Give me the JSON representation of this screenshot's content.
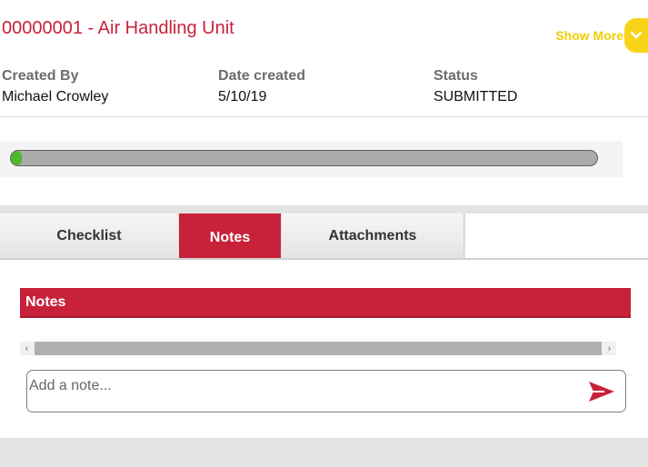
{
  "header": {
    "title": "00000001 - Air Handling Unit",
    "show_more_label": "Show More"
  },
  "meta": {
    "created_by_label": "Created By",
    "created_by_value": "Michael Crowley",
    "date_created_label": "Date created",
    "date_created_value": "5/10/19",
    "status_label": "Status",
    "status_value": "SUBMITTED"
  },
  "progress": {
    "fraction": 0.0
  },
  "tabs": [
    {
      "label": "Checklist",
      "active": false
    },
    {
      "label": "Notes",
      "active": true
    },
    {
      "label": "Attachments",
      "active": false
    }
  ],
  "notes": {
    "section_title": "Notes",
    "input_placeholder": "Add a note...",
    "input_value": ""
  },
  "icons": {
    "show_more": "chevron-down-icon",
    "send": "send-icon",
    "scroll_left": "chevron-left-icon",
    "scroll_right": "chevron-right-icon"
  },
  "colors": {
    "brand_red": "#c8213a",
    "show_more_yellow": "#f7d417",
    "progress_green": "#4cb82b",
    "progress_track": "#ababab"
  }
}
